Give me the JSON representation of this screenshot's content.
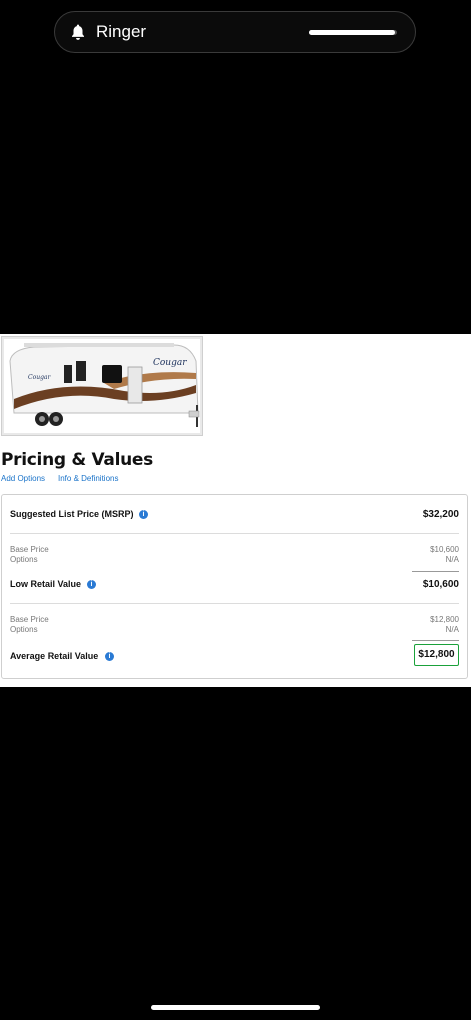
{
  "status": {
    "ringer_label": "Ringer",
    "bell_icon": "bell-icon",
    "volume_level": 0.98
  },
  "listing": {
    "image_alt": "Cougar travel trailer",
    "image_brand_text": "Cougar"
  },
  "pricing": {
    "title": "Pricing & Values",
    "links": {
      "add_options": "Add Options",
      "info_definitions": "Info & Definitions"
    },
    "msrp": {
      "label": "Suggested List Price (MSRP)",
      "value": "$32,200"
    },
    "low_retail": {
      "base_label": "Base Price",
      "base_value": "$10,600",
      "options_label": "Options",
      "options_value": "N/A",
      "label": "Low Retail Value",
      "value": "$10,600"
    },
    "average_retail": {
      "base_label": "Base Price",
      "base_value": "$12,800",
      "options_label": "Options",
      "options_value": "N/A",
      "label": "Average Retail Value",
      "value": "$12,800"
    },
    "info_icon_glyph": "i",
    "highlight_color": "#1aa13a",
    "link_color": "#1a73c9"
  }
}
